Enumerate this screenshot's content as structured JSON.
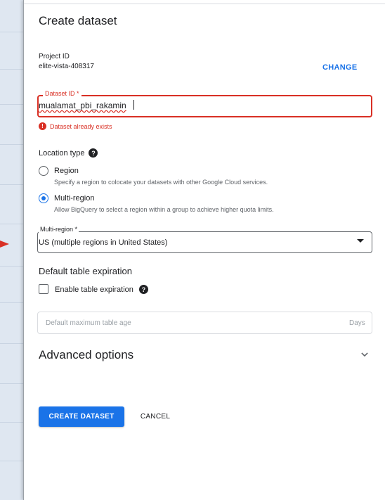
{
  "panel": {
    "title": "Create dataset",
    "project": {
      "label": "Project ID",
      "value": "elite-vista-408317",
      "change_label": "CHANGE"
    },
    "dataset_id": {
      "label": "Dataset ID *",
      "value": "mualamat_pbi_rakamin",
      "error": "Dataset already exists"
    },
    "location_type": {
      "label": "Location type",
      "help_icon": "help-icon",
      "options": [
        {
          "label": "Region",
          "description": "Specify a region to colocate your datasets with other Google Cloud services.",
          "selected": false
        },
        {
          "label": "Multi-region",
          "description": "Allow BigQuery to select a region within a group to achieve higher quota limits.",
          "selected": true
        }
      ]
    },
    "multi_region": {
      "label": "Multi-region *",
      "value": "US (multiple regions in United States)"
    },
    "default_table_expiration": {
      "title": "Default table expiration",
      "checkbox_label": "Enable table expiration",
      "checked": false,
      "age_placeholder": "Default maximum table age",
      "age_suffix": "Days"
    },
    "advanced_options": {
      "title": "Advanced options",
      "expanded": false
    },
    "buttons": {
      "create": "CREATE DATASET",
      "cancel": "CANCEL"
    }
  },
  "colors": {
    "accent": "#1a73e8",
    "error": "#d93025",
    "text": "#202124",
    "secondary_text": "#5f6368"
  }
}
